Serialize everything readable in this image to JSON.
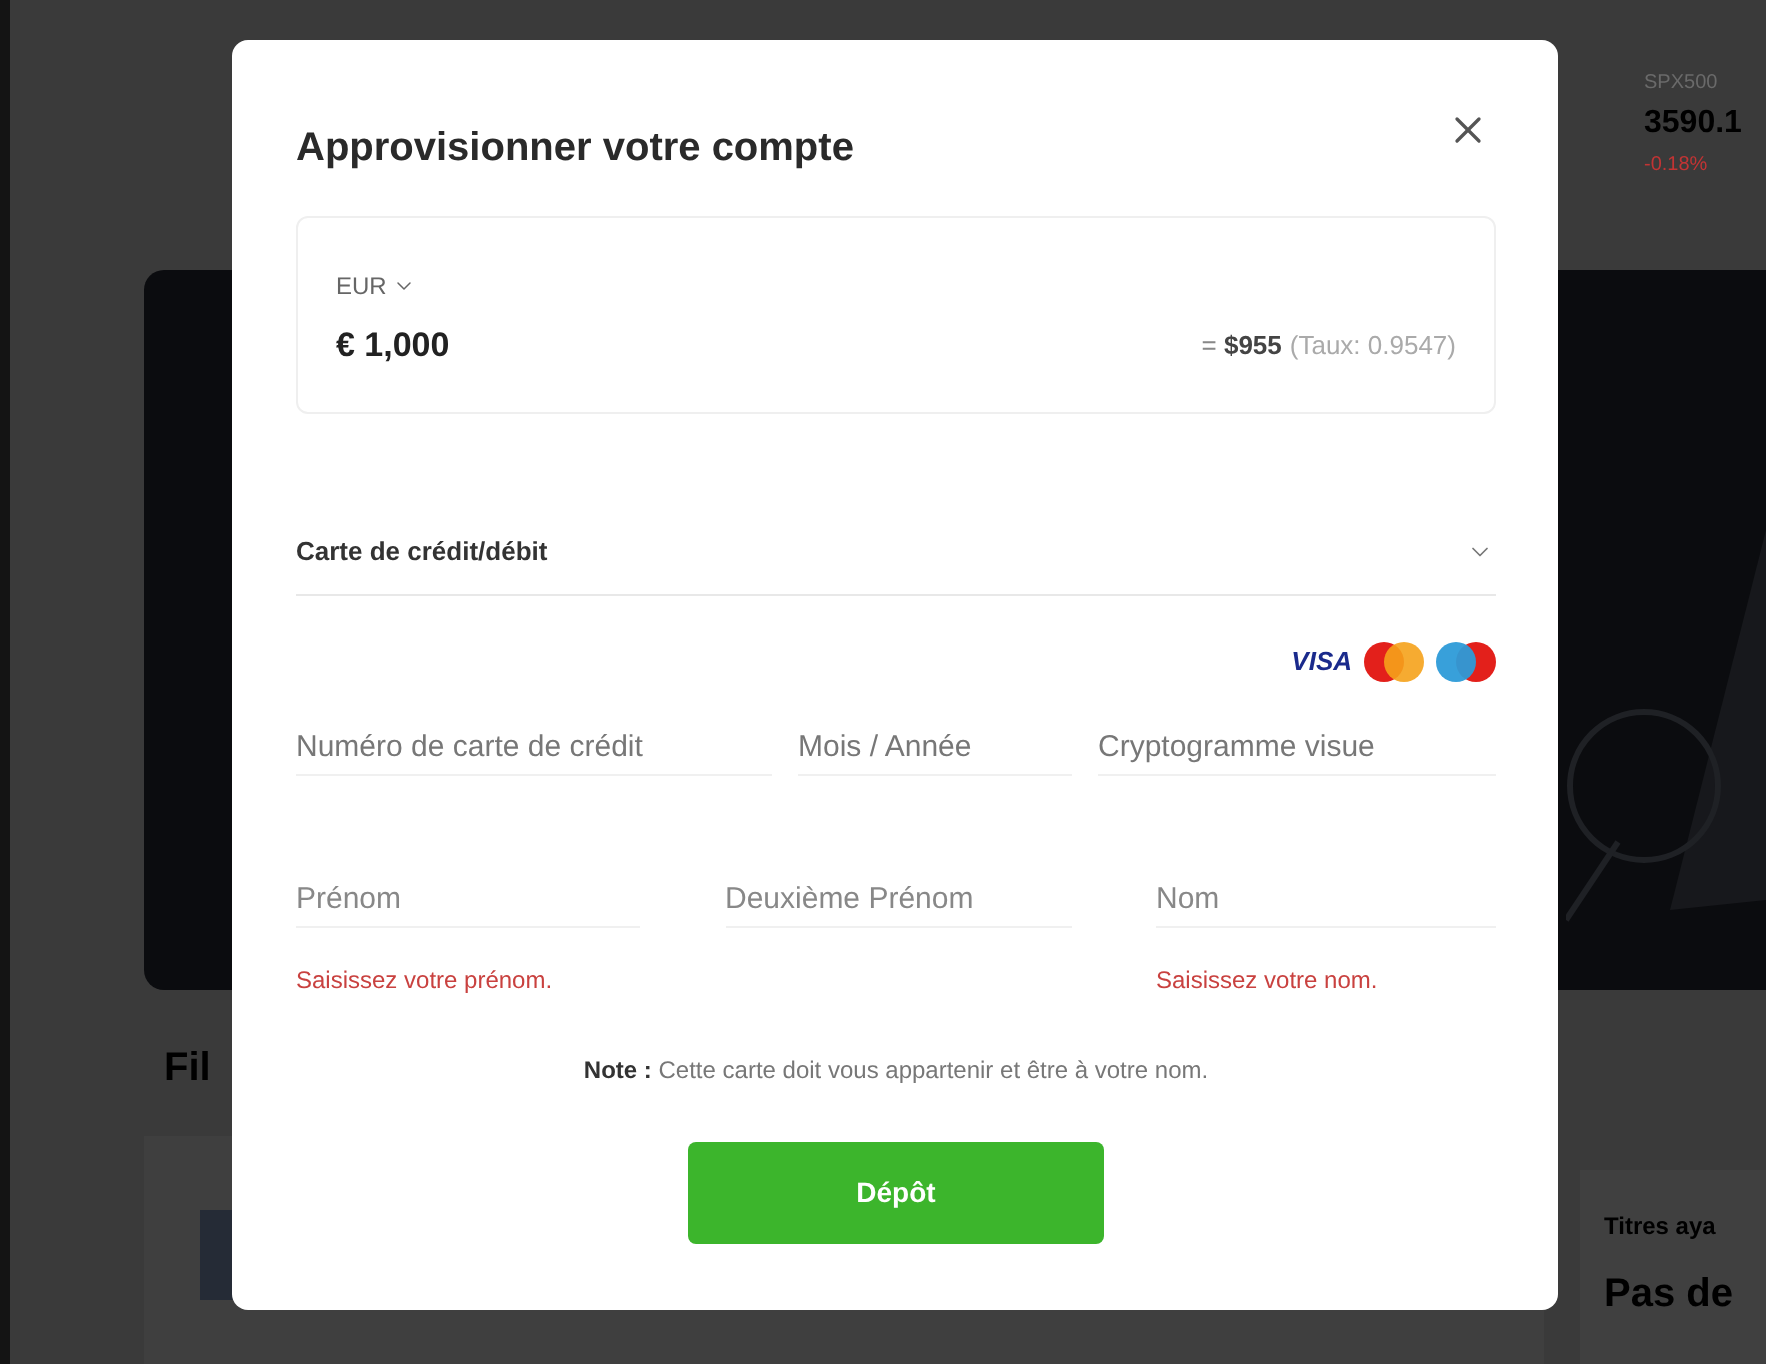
{
  "page": {
    "ticker": {
      "symbol": "SPX500",
      "price": "3590.1",
      "change": "-0.18%"
    },
    "section_title": "Fil",
    "side_card": {
      "label": "Titres aya",
      "heading": "Pas de"
    }
  },
  "dialog": {
    "title": "Approvisionner votre compte",
    "amount": {
      "currency": "EUR",
      "value": "€ 1,000",
      "converted": "= **$955**",
      "rate": "(Taux: 0.9547)"
    },
    "payment_method": "Carte de crédit/débit",
    "card_logos": [
      {
        "kind": "visa",
        "text": "VISA"
      },
      {
        "kind": "mastercard"
      },
      {
        "kind": "maestro"
      }
    ],
    "card_fields": [
      {
        "placeholder": "Numéro de carte de crédit"
      },
      {
        "placeholder": "Mois / Année"
      },
      {
        "placeholder": "Cryptogramme visue"
      }
    ],
    "name_fields": [
      {
        "placeholder": "Prénom",
        "error": "Saisissez votre prénom."
      },
      {
        "placeholder": "Deuxième Prénom"
      },
      {
        "placeholder": "Nom",
        "error": "Saisissez votre nom."
      }
    ],
    "note": "**Note :** Cette carte doit vous appartenir et être à votre nom.",
    "submit": "Dépôt"
  }
}
